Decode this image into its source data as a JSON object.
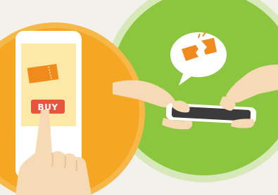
{
  "illustration": {
    "buy_label": "BUY",
    "colors": {
      "background": "#f3f1ec",
      "orange_circle": "#f5a623",
      "orange_circle_dark": "#f09a1a",
      "green_circle": "#8cc63f",
      "green_ring": "#d7e9b9",
      "phone_frame": "#ffffff",
      "phone_screen": "#fce9a8",
      "ticket": "#f08a1c",
      "buy_button": "#e8553d",
      "skin": "#f6d9b5",
      "skin_shadow": "#e8c49a",
      "bubble": "#ffffff",
      "phone_dark": "#3b3b3b"
    },
    "icons": [
      "pointing-hand-icon",
      "smartphone-icon",
      "ticket-icon",
      "torn-ticket-icon",
      "speech-bubble-icon",
      "buy-button"
    ]
  }
}
